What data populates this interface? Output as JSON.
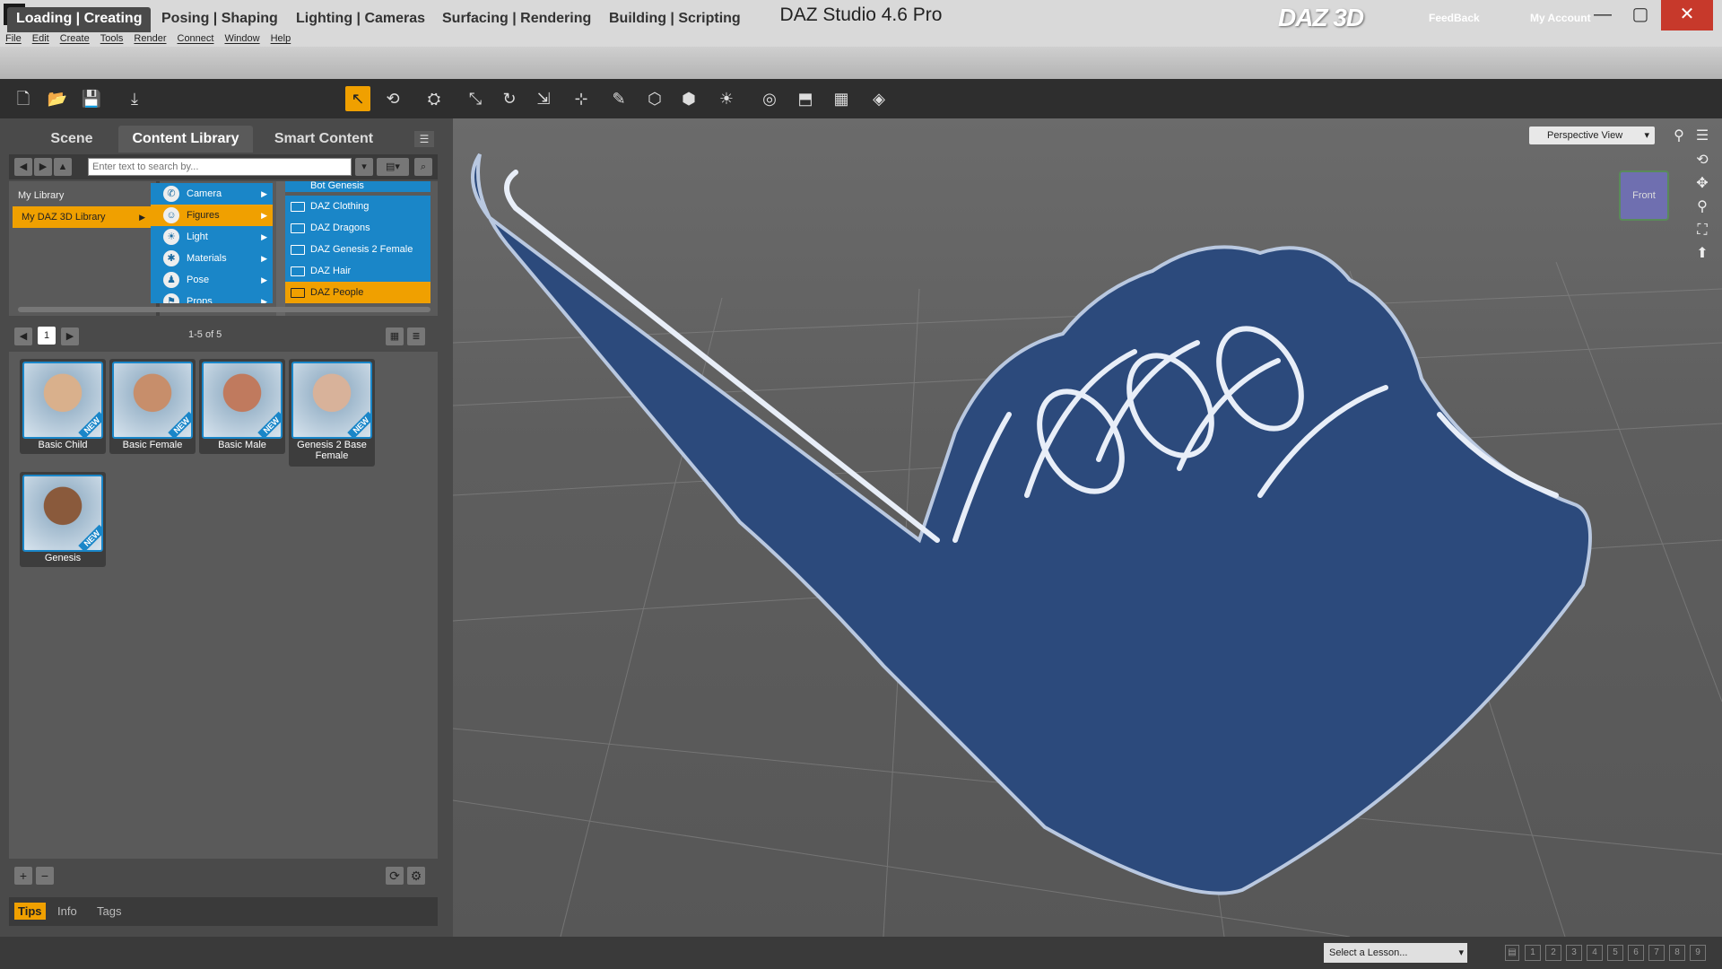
{
  "window": {
    "title": "DAZ Studio 4.6 Pro",
    "minimize": "—",
    "maximize": "▢",
    "close": "✕"
  },
  "menu": [
    "File",
    "Edit",
    "Create",
    "Tools",
    "Render",
    "Connect",
    "Window",
    "Help"
  ],
  "workspace_tabs": [
    "Loading | Creating",
    "Posing | Shaping",
    "Lighting | Cameras",
    "Surfacing | Rendering",
    "Building | Scripting"
  ],
  "brand": {
    "logo": "DAZ 3D",
    "feedback": "FeedBack",
    "account": "My Account"
  },
  "toolbar": {
    "icons": [
      "new-file-icon",
      "open-file-icon",
      "save-file-icon",
      "import-icon",
      "select-tool-icon",
      "node-select-icon",
      "universal-tool-icon",
      "translate-tool-icon",
      "rotate-tool-icon",
      "scale-tool-icon",
      "joint-editor-icon",
      "morph-tool-icon",
      "geometry-tool-icon",
      "surface-tool-icon",
      "light-icon",
      "camera-icon",
      "scene-icon",
      "region-icon",
      "render-icon"
    ],
    "glyphs": [
      "🗋",
      "📂",
      "💾",
      "⤓",
      "↖",
      "⟲",
      "⛭",
      "⤡",
      "↻",
      "⇲",
      "⊹",
      "✎",
      "⬡",
      "⬢",
      "☀",
      "◎",
      "⬒",
      "▦",
      "◈"
    ]
  },
  "panel_tabs": {
    "scene": "Scene",
    "content": "Content Library",
    "smart": "Smart Content"
  },
  "search": {
    "placeholder": "Enter text to search by..."
  },
  "library": {
    "items": [
      "My Library",
      "My DAZ 3D Library"
    ]
  },
  "categories": [
    {
      "label": "Camera",
      "glyph": "✆"
    },
    {
      "label": "Figures",
      "glyph": "☺"
    },
    {
      "label": "Light",
      "glyph": "☀"
    },
    {
      "label": "Materials",
      "glyph": "✱"
    },
    {
      "label": "Pose",
      "glyph": "♟"
    },
    {
      "label": "Props",
      "glyph": "⚑"
    }
  ],
  "folders": [
    "Bot Genesis",
    "DAZ Clothing",
    "DAZ Dragons",
    "DAZ Genesis 2 Female",
    "DAZ Hair",
    "DAZ People"
  ],
  "pager": {
    "page": "1",
    "results": "1-5 of 5"
  },
  "content_items": [
    {
      "label": "Basic Child",
      "badge": "NEW",
      "color": "#d9b08c"
    },
    {
      "label": "Basic Female",
      "badge": "NEW",
      "color": "#c78e6b"
    },
    {
      "label": "Basic Male",
      "badge": "NEW",
      "color": "#c07a5e"
    },
    {
      "label": "Genesis 2 Base Female",
      "badge": "NEW",
      "color": "#d8b29a"
    },
    {
      "label": "Genesis",
      "badge": "NEW",
      "color": "#8a5a3c"
    }
  ],
  "bottom_tabs": [
    "Tips",
    "Info",
    "Tags"
  ],
  "viewport": {
    "view": "Perspective View",
    "cube_label": "Front"
  },
  "status": {
    "lesson": "Select a Lesson...",
    "steps": [
      "1",
      "2",
      "3",
      "4",
      "5",
      "6",
      "7",
      "8",
      "9"
    ]
  },
  "colors": {
    "accent": "#f0a000",
    "selection_blue": "#1a86c8",
    "foam_hand": "#2c4a7c",
    "close": "#c7392b"
  }
}
